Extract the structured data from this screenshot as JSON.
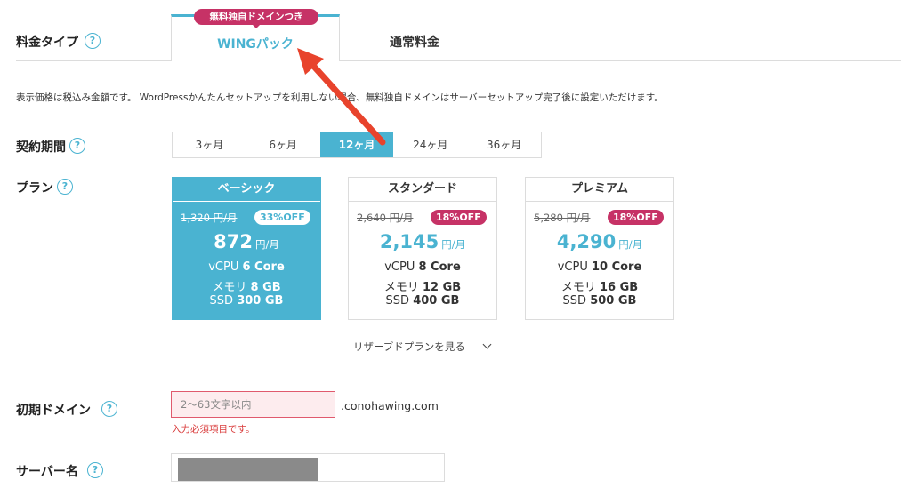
{
  "price_type": {
    "label": "料金タイプ"
  },
  "tabs": {
    "wing": {
      "badge": "無料独自ドメインつき",
      "label": "WINGパック"
    },
    "normal": {
      "label": "通常料金"
    }
  },
  "note": "表示価格は税込み金額です。 WordPressかんたんセットアップを利用しない場合、無料独自ドメインはサーバーセットアップ完了後に設定いただけます。",
  "period": {
    "label": "契約期間",
    "options": [
      "3ヶ月",
      "6ヶ月",
      "12ヶ月",
      "24ヶ月",
      "36ヶ月"
    ],
    "selected": "12ヶ月"
  },
  "plan": {
    "label": "プラン",
    "cards": [
      {
        "name": "ベーシック",
        "old_price": "1,320 円/月",
        "discount": "33%OFF",
        "price": "872",
        "unit": "円/月",
        "cpu_label": "vCPU",
        "cpu": "6 Core",
        "mem_label": "メモリ",
        "mem": "8 GB",
        "ssd_label": "SSD",
        "ssd": "300 GB"
      },
      {
        "name": "スタンダード",
        "old_price": "2,640 円/月",
        "discount": "18%OFF",
        "price": "2,145",
        "unit": "円/月",
        "cpu_label": "vCPU",
        "cpu": "8 Core",
        "mem_label": "メモリ",
        "mem": "12 GB",
        "ssd_label": "SSD",
        "ssd": "400 GB"
      },
      {
        "name": "プレミアム",
        "old_price": "5,280 円/月",
        "discount": "18%OFF",
        "price": "4,290",
        "unit": "円/月",
        "cpu_label": "vCPU",
        "cpu": "10 Core",
        "mem_label": "メモリ",
        "mem": "16 GB",
        "ssd_label": "SSD",
        "ssd": "500 GB"
      }
    ],
    "selected": "ベーシック",
    "reserve_link": "リザーブドプランを見る"
  },
  "domain": {
    "label": "初期ドメイン",
    "placeholder": "2〜63文字以内",
    "suffix": ".conohawing.com",
    "error": "入力必須項目です。"
  },
  "server": {
    "label": "サーバー名"
  },
  "icons": {
    "help": "help-circle-icon",
    "chevron": "chevron-down-icon",
    "arrow": "annotation-arrow"
  },
  "colors": {
    "accent": "#4ab3d1",
    "badge": "#c63266",
    "error": "#d93a3a",
    "arrow": "#e8432c"
  }
}
